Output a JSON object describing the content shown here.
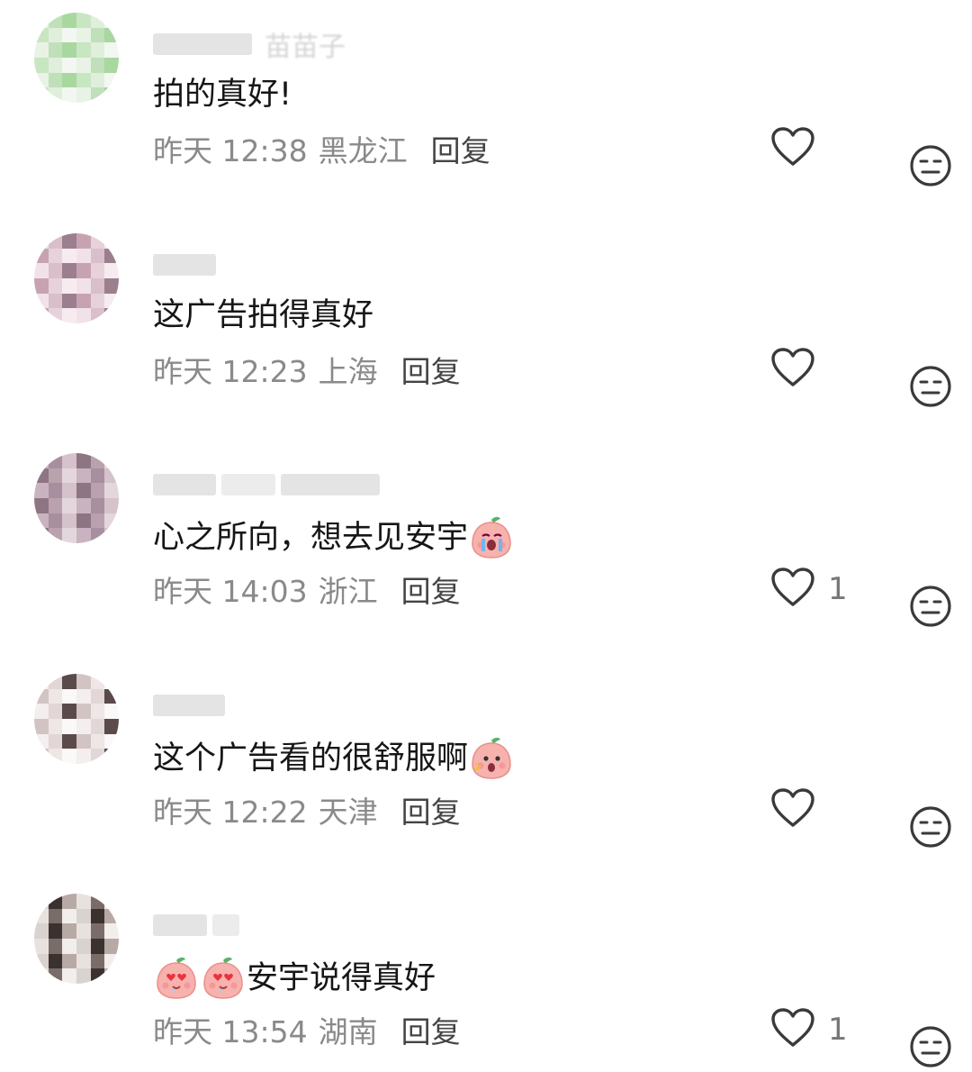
{
  "comments": [
    {
      "text_before": "",
      "text": "拍的真好!",
      "time": "昨天 12:38",
      "location": "黑龙江",
      "reply_label": "回复",
      "like_count": "",
      "emojis_before": [],
      "emojis_after": [],
      "name_prefix_visible": "苗苗子",
      "avatar_colors": [
        "#e8f3e6",
        "#bfe0b9",
        "#a9d7a0",
        "#c7e6c1",
        "#e0efdc",
        "#f3f7f2"
      ]
    },
    {
      "text": "这广告拍得真好",
      "time": "昨天 12:23",
      "location": "上海",
      "reply_label": "回复",
      "like_count": "",
      "emojis_before": [],
      "emojis_after": [],
      "avatar_colors": [
        "#f1e2e9",
        "#d9bfc9",
        "#9b7f8f",
        "#c7a3b2",
        "#e7d2dc",
        "#f6ecf0"
      ]
    },
    {
      "text": "心之所向，想去见安宇",
      "time": "昨天 14:03",
      "location": "浙江",
      "reply_label": "回复",
      "like_count": "1",
      "emojis_before": [],
      "emojis_after": [
        "crying-peach-emoji"
      ],
      "avatar_colors": [
        "#c9b3c0",
        "#a88fa0",
        "#d5c2cb",
        "#8e7583",
        "#b9a2ae",
        "#e3d6dc"
      ]
    },
    {
      "text": "这个广告看的很舒服啊",
      "time": "昨天 12:22",
      "location": "天津",
      "reply_label": "回复",
      "like_count": "",
      "emojis_before": [],
      "emojis_after": [
        "surprised-peach-emoji"
      ],
      "avatar_colors": [
        "#f4eeee",
        "#e2d6d6",
        "#5a4a4a",
        "#d3c4c4",
        "#efe6e6",
        "#fbf8f8"
      ]
    },
    {
      "text": "安宇说得真好",
      "time": "昨天 13:54",
      "location": "湖南",
      "reply_label": "回复",
      "like_count": "1",
      "emojis_before": [
        "heart-eyes-peach-emoji",
        "heart-eyes-peach-emoji"
      ],
      "emojis_after": [],
      "avatar_colors": [
        "#d9d3d0",
        "#3b3230",
        "#b7aaa5",
        "#e8e1de",
        "#7a6d69",
        "#f2eeec"
      ]
    }
  ],
  "colors": {
    "text": "#161616",
    "meta": "#8a8a8a",
    "reply": "#444444",
    "icon": "#3a3a3a",
    "peach": "#f7b2ae"
  }
}
